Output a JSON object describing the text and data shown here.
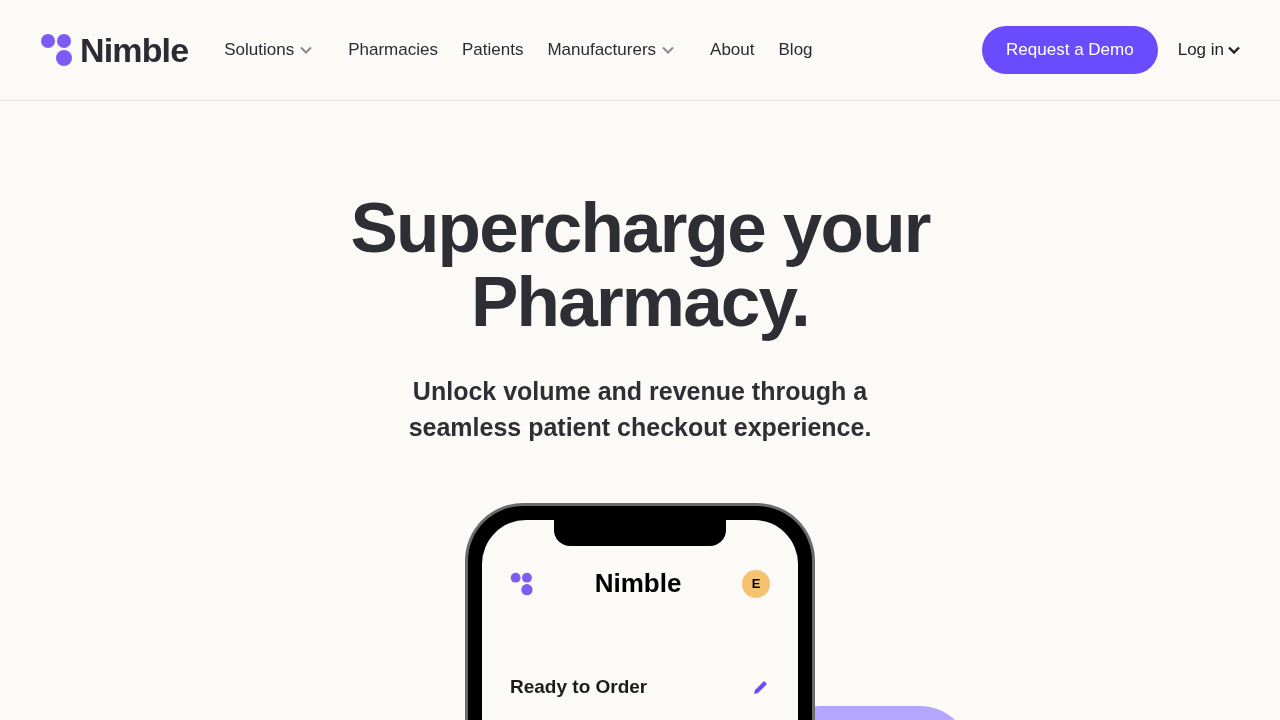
{
  "brand": "Nimble",
  "nav": [
    {
      "label": "Solutions",
      "dropdown": true
    },
    {
      "label": "Pharmacies",
      "dropdown": false
    },
    {
      "label": "Patients",
      "dropdown": false
    },
    {
      "label": "Manufacturers",
      "dropdown": true
    },
    {
      "label": "About",
      "dropdown": false
    },
    {
      "label": "Blog",
      "dropdown": false
    }
  ],
  "cta": "Request a Demo",
  "login": "Log in",
  "hero": {
    "title_lines": [
      "Supercharge your",
      "Pharmacy."
    ],
    "subtitle_lines": [
      "Unlock volume and revenue through a",
      "seamless patient checkout experience."
    ]
  },
  "phone": {
    "app_title": "Nimble",
    "avatar": "E",
    "section": "Ready to Order"
  }
}
